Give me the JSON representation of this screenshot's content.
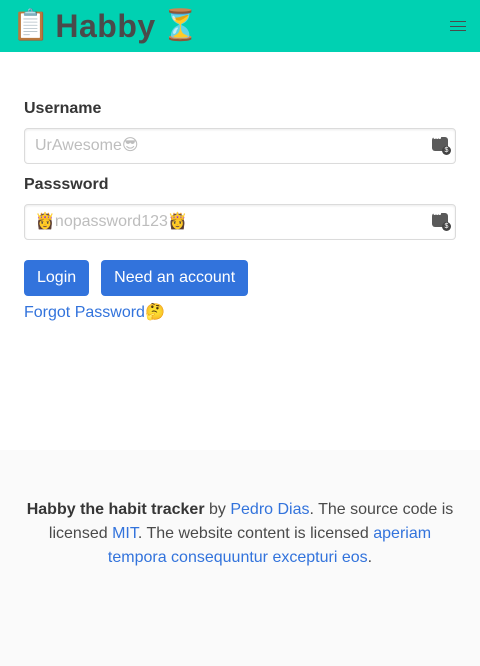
{
  "navbar": {
    "brand_left_emoji": "📋",
    "brand_title": "Habby",
    "brand_right_emoji": "⏳",
    "menu_icon": "hamburger-icon"
  },
  "form": {
    "username_label": "Username",
    "username_placeholder": "UrAwesome😎",
    "password_label": "Passsword",
    "password_placeholder": "👸nopassword123👸",
    "field_icon": "password-manager-icon",
    "login_button": "Login",
    "register_button": "Need an account",
    "forgot_link": "Forgot Password🤔"
  },
  "footer": {
    "app_name": "Habby the habit tracker",
    "by_text": " by ",
    "author": "Pedro Dias",
    "source_text": ". The source code is licensed ",
    "code_license": "MIT",
    "content_text": ". The website content is licensed ",
    "content_license": "aperiam tempora consequuntur excepturi eos",
    "end_text": "."
  },
  "colors": {
    "navbar": "#00d1b2",
    "primary": "#3273dc",
    "footer_bg": "#fafafa"
  }
}
